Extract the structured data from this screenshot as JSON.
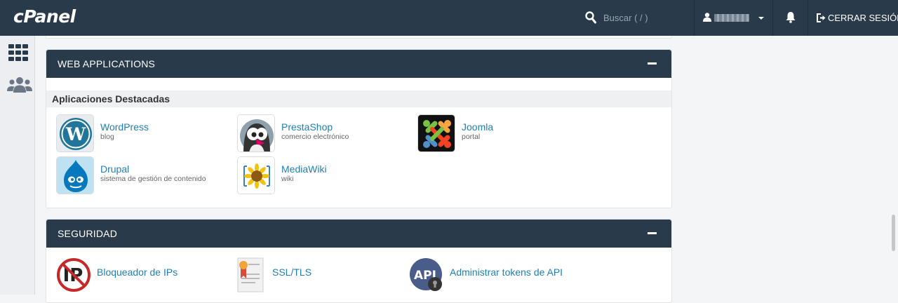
{
  "header": {
    "logo": "cPanel",
    "search_placeholder": "Buscar ( / )",
    "logout_label": "CERRAR SESIÓN"
  },
  "sidebar": {
    "items": [
      {
        "icon": "grid-icon"
      },
      {
        "icon": "users-icon"
      }
    ]
  },
  "web_applications": {
    "title": "WEB APPLICATIONS",
    "featured_title": "Aplicaciones Destacadas",
    "apps": [
      {
        "name": "WordPress",
        "desc": "blog",
        "icon": "wordpress-icon"
      },
      {
        "name": "PrestaShop",
        "desc": "comercio electrónico",
        "icon": "prestashop-icon"
      },
      {
        "name": "Joomla",
        "desc": "portal",
        "icon": "joomla-icon"
      },
      {
        "name": "Drupal",
        "desc": "sistema de gestión de contenido",
        "icon": "drupal-icon"
      },
      {
        "name": "MediaWiki",
        "desc": "wiki",
        "icon": "mediawiki-icon"
      }
    ]
  },
  "security": {
    "title": "SEGURIDAD",
    "items": [
      {
        "label": "Bloqueador de IPs",
        "icon": "ip-blocker-icon"
      },
      {
        "label": "SSL/TLS",
        "icon": "certificate-icon"
      },
      {
        "label": "Administrar tokens de API",
        "icon": "api-token-icon"
      }
    ]
  },
  "colors": {
    "header_bg": "#293a4a",
    "link": "#1f7fb6",
    "page_bg": "#f4f5f7"
  }
}
